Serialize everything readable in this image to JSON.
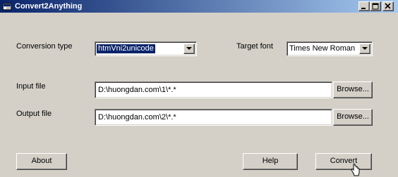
{
  "window": {
    "title": "Convert2Anything",
    "icons": {
      "app": "app-icon",
      "minimize": "minimize-icon",
      "maximize": "maximize-icon",
      "close": "close-icon"
    }
  },
  "form": {
    "conversion_type_label": "Conversion type",
    "conversion_type_value": "htmVni2unicode",
    "target_font_label": "Target font",
    "target_font_value": "Times New Roman",
    "input_file_label": "Input file",
    "input_file_value": "D:\\huongdan.com\\1\\*.*",
    "output_file_label": "Output file",
    "output_file_value": "D:\\huongdan.com\\2\\*.*",
    "browse_label": "Browse..."
  },
  "buttons": {
    "about": "About",
    "help": "Help",
    "convert": "Convert"
  },
  "colors": {
    "titlebar_start": "#0a246a",
    "titlebar_end": "#a6caf0",
    "face": "#d4d0c8",
    "selection": "#0a246a"
  }
}
